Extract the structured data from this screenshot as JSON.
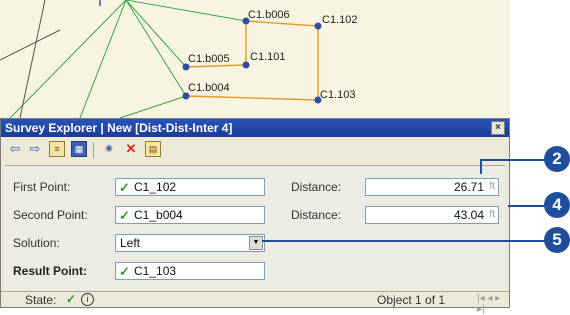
{
  "map": {
    "labels": {
      "b006": "C1.b006",
      "p102": "C1.102",
      "b005": "C1.b005",
      "p101": "C1.101",
      "b004": "C1.b004",
      "p103": "C1.103"
    }
  },
  "dialog": {
    "title": "Survey Explorer | New [Dist-Dist-Inter 4]",
    "close": "×",
    "toolbar": {
      "back_icon": "⇦",
      "forward_icon": "⇨",
      "doc_icon": "≡",
      "calc_icon": "▦",
      "star_icon": "⁕",
      "delete_icon": "✕",
      "report_icon": "▤"
    },
    "fields": {
      "first_point_label": "First Point:",
      "first_point_value": "C1_102",
      "second_point_label": "Second Point:",
      "second_point_value": "C1_b004",
      "solution_label": "Solution:",
      "solution_value": "Left",
      "result_point_label": "Result Point:",
      "result_point_value": "C1_103",
      "distance1_label": "Distance:",
      "distance1_value": "26.71",
      "distance2_label": "Distance:",
      "distance2_value": "43.04",
      "unit": "ft",
      "check_mark": "✓",
      "dropdown_arrow": "▼"
    },
    "status": {
      "state_label": "State:",
      "state_check": "✓",
      "info": "i",
      "object": "Object 1 of 1",
      "nav": "|◂ ◂ ▸ ▸|"
    }
  },
  "callouts": [
    "2",
    "4",
    "5"
  ],
  "colors": {
    "map_background": "#f7f5e1",
    "parcel_line": "#e8952a",
    "green_line": "#3aa24a",
    "point": "#2e4e9c",
    "title_bar": "#1a3c96",
    "callout": "#1f4e9c",
    "check": "#2f9a2f"
  }
}
